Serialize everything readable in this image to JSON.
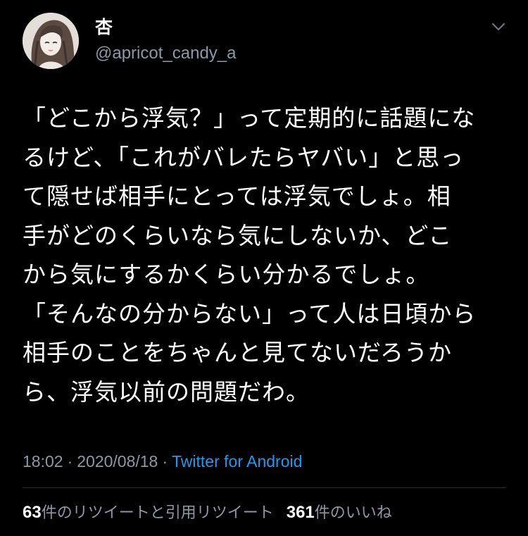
{
  "user": {
    "display_name": "杏",
    "handle": "@apricot_candy_a"
  },
  "tweet": {
    "lines": [
      "「どこから浮気？」って定期的に話題にな",
      "るけど、「これがバレたらヤバい」と思っ",
      "て隠せば相手にとっては浮気でしょ。相",
      "手がどのくらいなら気にしないか、どこ",
      "から気にするかくらい分かるでしょ。",
      "「そんなの分からない」って人は日頃から",
      "相手のことをちゃんと見てないだろうか",
      "ら、浮気以前の問題だわ。"
    ]
  },
  "meta": {
    "time": "18:02",
    "separator": "·",
    "date": "2020/08/18",
    "source": "Twitter for Android"
  },
  "stats": {
    "retweets_count": "63",
    "retweets_label": "件のリツイートと引用リツイート",
    "likes_count": "361",
    "likes_label": "件のいいね"
  },
  "icons": {
    "menu": "chevron-down-icon",
    "avatar": "avatar"
  },
  "colors": {
    "background": "#000000",
    "text": "#ffffff",
    "secondary": "#8b98a5",
    "link": "#1d9bf0",
    "divider": "#2f3336"
  }
}
